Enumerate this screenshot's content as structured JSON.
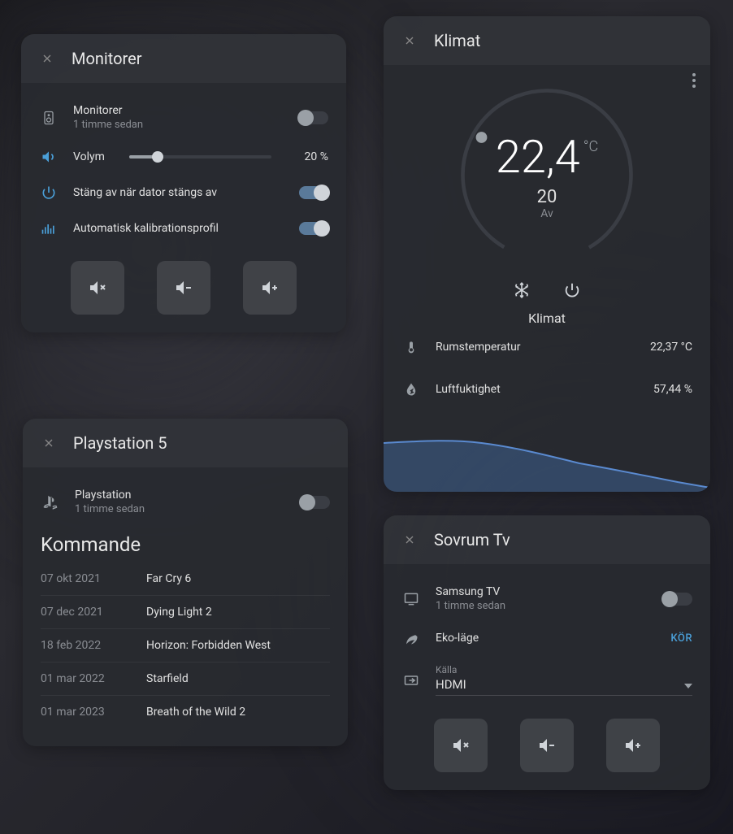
{
  "monitorer": {
    "title": "Monitorer",
    "device": {
      "name": "Monitorer",
      "sub": "1 timme sedan",
      "on": false
    },
    "volume": {
      "label": "Volym",
      "percent": 20,
      "display": "20 %"
    },
    "shutdown": {
      "label": "Stäng av när dator stängs av",
      "on": true
    },
    "calib": {
      "label": "Automatisk kalibrationsprofil",
      "on": true
    }
  },
  "ps5": {
    "title": "Playstation 5",
    "device": {
      "name": "Playstation",
      "sub": "1 timme sedan",
      "on": false
    },
    "upcoming_title": "Kommande",
    "upcoming": [
      {
        "date": "07 okt 2021",
        "title": "Far Cry 6"
      },
      {
        "date": "07 dec 2021",
        "title": "Dying Light 2"
      },
      {
        "date": "18 feb 2022",
        "title": "Horizon: Forbidden West"
      },
      {
        "date": "01 mar 2022",
        "title": "Starfield"
      },
      {
        "date": "01 mar 2023",
        "title": "Breath of the Wild 2"
      }
    ]
  },
  "klimat": {
    "title": "Klimat",
    "current": "22,4",
    "unit": "°C",
    "target": "20",
    "state": "Av",
    "label": "Klimat",
    "room_temp": {
      "label": "Rumstemperatur",
      "value": "22,37 °C"
    },
    "humidity": {
      "label": "Luftfuktighet",
      "value": "57,44 %"
    }
  },
  "tv": {
    "title": "Sovrum Tv",
    "device": {
      "name": "Samsung TV",
      "sub": "1 timme sedan",
      "on": false
    },
    "eco": {
      "label": "Eko-läge",
      "action": "KÖR"
    },
    "source": {
      "label": "Källa",
      "value": "HDMI"
    }
  },
  "chart_data": {
    "type": "area",
    "series": [
      {
        "name": "Rumstemperatur",
        "values": [
          22.8,
          22.9,
          22.7,
          22.5,
          22.4,
          22.3,
          22.1,
          21.9,
          21.7,
          21.5,
          21.3,
          21.0
        ]
      }
    ],
    "ylim": [
      20,
      24
    ],
    "xlabel": "",
    "ylabel": ""
  }
}
